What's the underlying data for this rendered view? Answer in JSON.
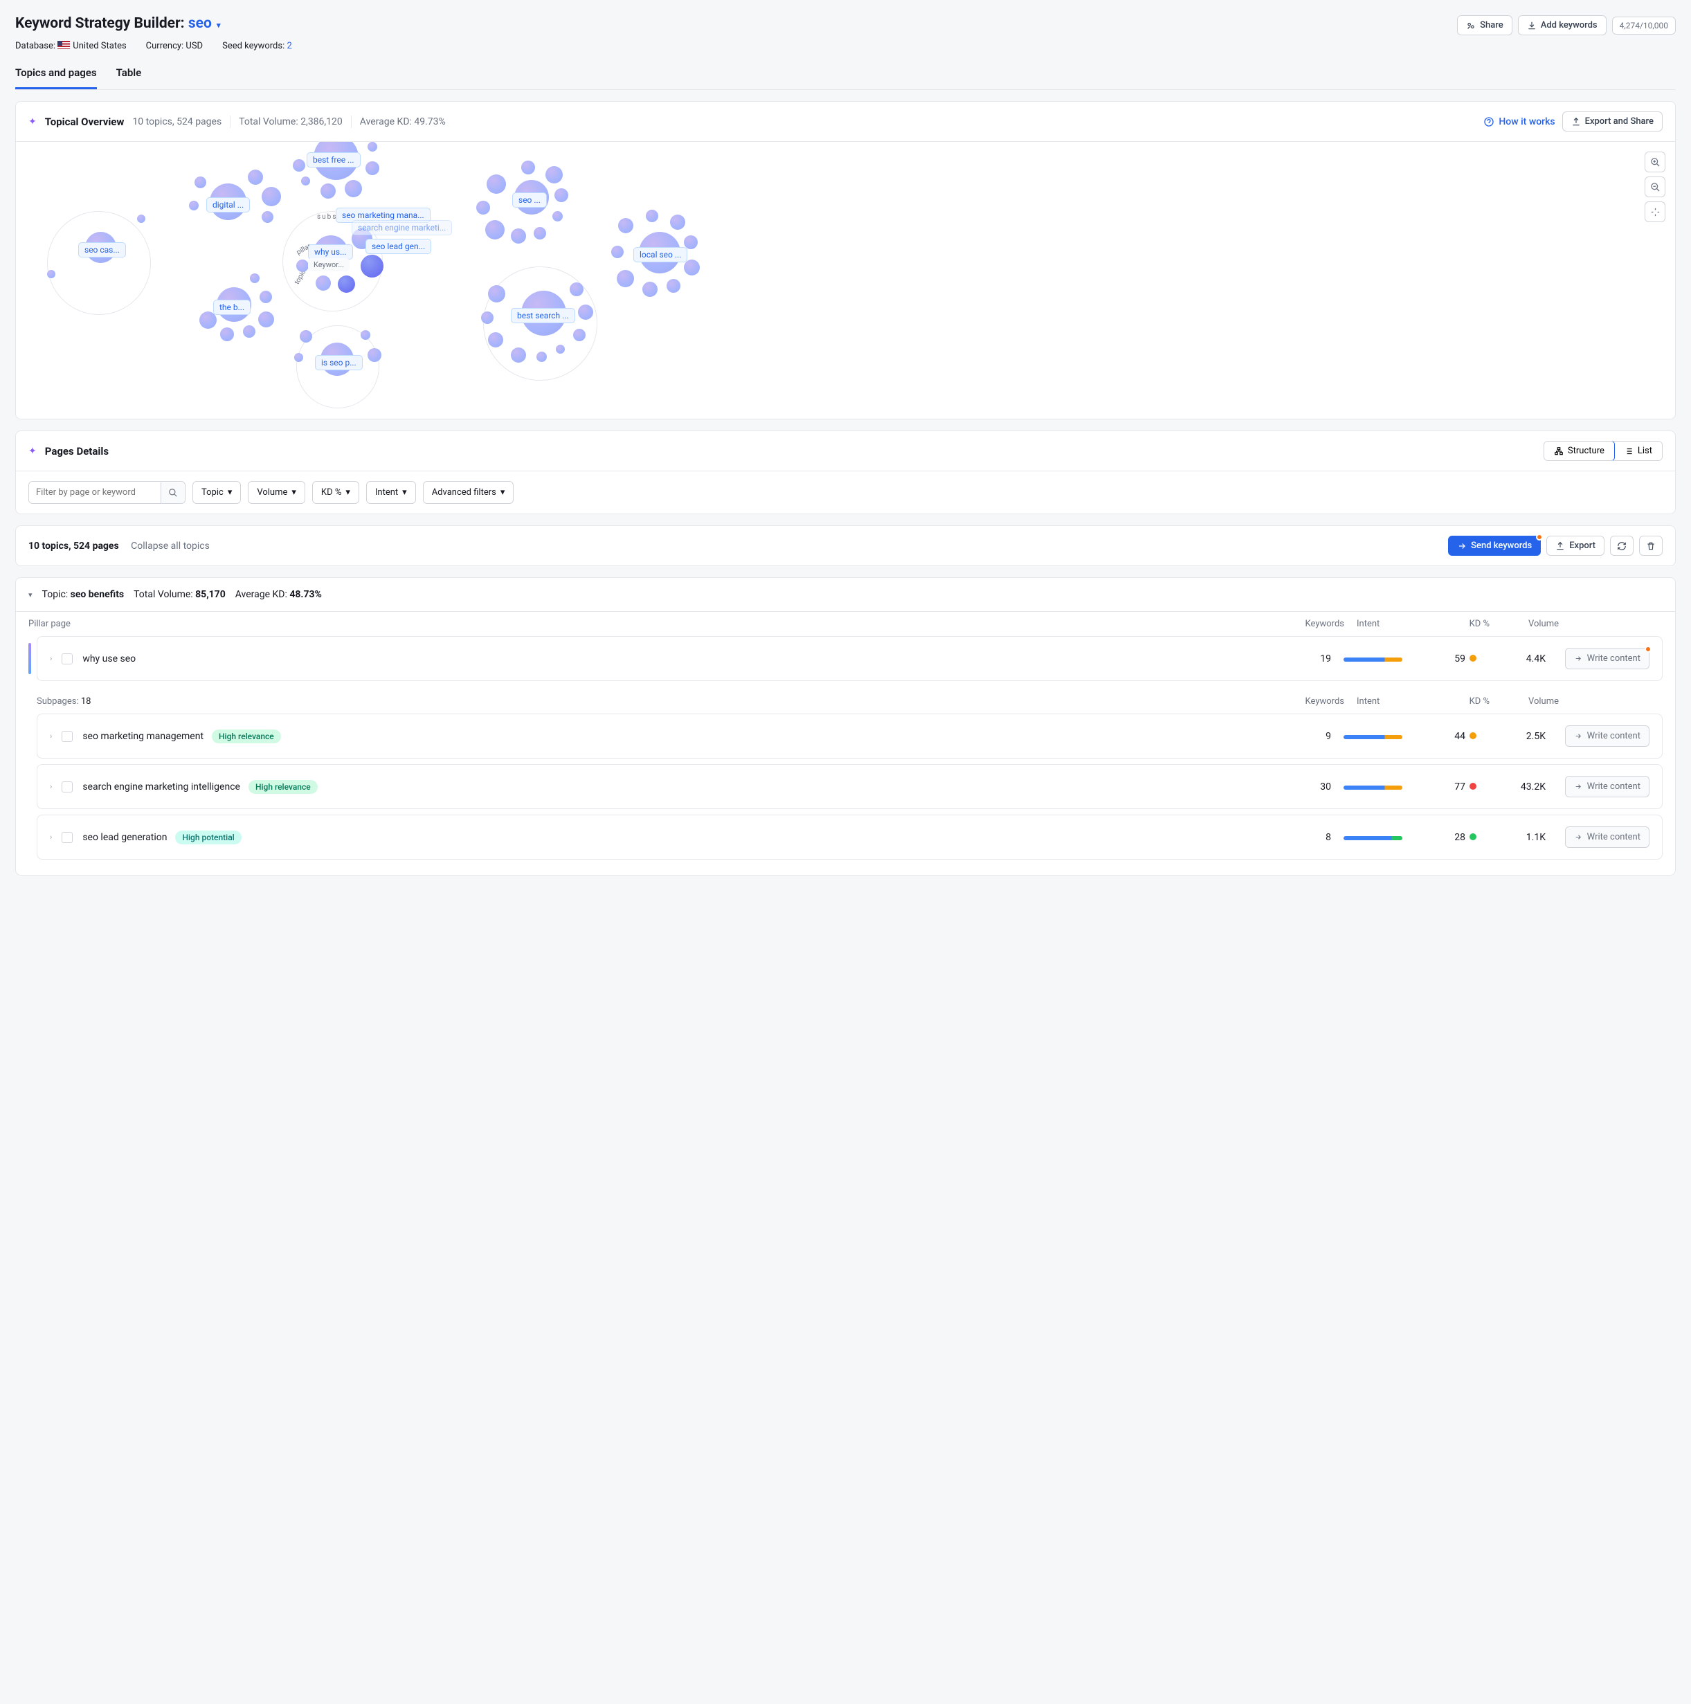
{
  "header": {
    "title_prefix": "Keyword Strategy Builder:",
    "selected": "seo",
    "share": "Share",
    "add": "Add keywords",
    "counter": "4,274/10,000"
  },
  "meta": {
    "db_label": "Database:",
    "db_value": "United States",
    "cur_label": "Currency:",
    "cur_value": "USD",
    "seed_label": "Seed keywords:",
    "seed_value": "2"
  },
  "tabs": {
    "t1": "Topics and pages",
    "t2": "Table"
  },
  "overview": {
    "title": "Topical Overview",
    "summary": "10 topics, 524 pages",
    "vol": "Total Volume: 2,386,120",
    "kd": "Average KD: 49.73%",
    "how": "How it works",
    "export": "Export and Share",
    "orbit_labels": {
      "topic": "topic",
      "subs": "subs",
      "pillar": "pillar"
    },
    "clusters": [
      {
        "id": "seo-cas",
        "label": "seo cas..."
      },
      {
        "id": "digital",
        "label": "digital ..."
      },
      {
        "id": "the-b",
        "label": "the b..."
      },
      {
        "id": "best-free",
        "label": "best free ..."
      },
      {
        "id": "why-us",
        "label": "why us...",
        "sub": "Keywor..."
      },
      {
        "id": "seo-mkt",
        "label": "seo marketing mana..."
      },
      {
        "id": "search-eng",
        "label": "search engine marketi..."
      },
      {
        "id": "seo-lead",
        "label": "seo lead gen..."
      },
      {
        "id": "is-seo",
        "label": "is seo p..."
      },
      {
        "id": "seo",
        "label": "seo ..."
      },
      {
        "id": "best-search",
        "label": "best search ..."
      },
      {
        "id": "local-seo",
        "label": "local seo ..."
      }
    ]
  },
  "details": {
    "title": "Pages Details",
    "structure": "Structure",
    "list": "List",
    "filter_ph": "Filter by page or keyword",
    "drops": [
      "Topic",
      "Volume",
      "KD %",
      "Intent",
      "Advanced filters"
    ]
  },
  "bar": {
    "summary": "10 topics, 524 pages",
    "collapse": "Collapse all topics",
    "send": "Send keywords",
    "export": "Export"
  },
  "topic": {
    "prefix": "Topic:",
    "name": "seo benefits",
    "vol_l": "Total Volume:",
    "vol": "85,170",
    "kd_l": "Average KD:",
    "kd": "48.73%",
    "pillar_h": "Pillar page",
    "sub_h": "Subpages:",
    "sub_n": "18",
    "cols": {
      "kw": "Keywords",
      "int": "Intent",
      "kd": "KD %",
      "vol": "Volume"
    },
    "write": "Write content",
    "pillar": {
      "name": "why use seo",
      "kw": "19",
      "kd": "59",
      "vol": "4.4K",
      "kd_color": "#f59e0b"
    },
    "subs": [
      {
        "name": "seo marketing management",
        "badge": "High relevance",
        "badge_cls": "hr",
        "kw": "9",
        "kd": "44",
        "vol": "2.5K",
        "kd_color": "#f59e0b"
      },
      {
        "name": "search engine marketing intelligence",
        "badge": "High relevance",
        "badge_cls": "hr",
        "kw": "30",
        "kd": "77",
        "vol": "43.2K",
        "kd_color": "#ef4444"
      },
      {
        "name": "seo lead generation",
        "badge": "High potential",
        "badge_cls": "hp",
        "kw": "8",
        "kd": "28",
        "vol": "1.1K",
        "kd_color": "#22c55e",
        "intent_alt": true
      }
    ]
  }
}
